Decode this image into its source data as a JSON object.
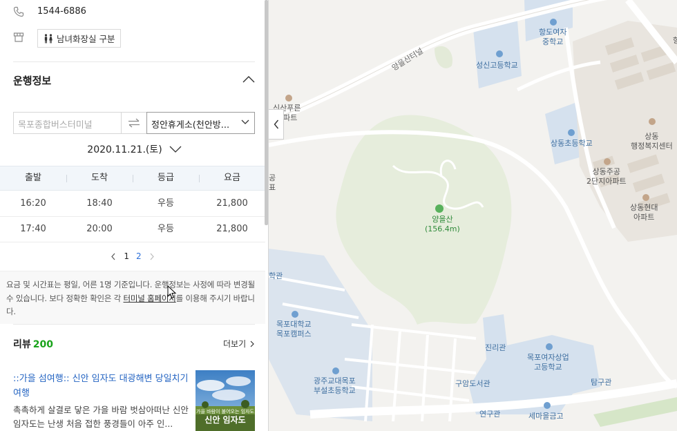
{
  "station": {
    "phone": "1544-6886",
    "toilet_badge": "남녀화장실 구분"
  },
  "schedule": {
    "section_title": "운행정보",
    "from_placeholder": "목포종합버스터미널",
    "to_value": "정안휴게소(천안방...",
    "date": "2020.11.21.(토)",
    "columns": [
      "출발",
      "도착",
      "등급",
      "요금"
    ],
    "rows": [
      {
        "depart": "16:20",
        "arrive": "18:40",
        "grade": "우등",
        "fare": "21,800"
      },
      {
        "depart": "17:40",
        "arrive": "20:00",
        "grade": "우등",
        "fare": "21,800"
      }
    ],
    "pages": [
      "1",
      "2"
    ],
    "current_page": "2",
    "notice_part1": "요금 및 시간표는 평일, 어른 1명 기준입니다. 운행정보는 사정에 따라 변경될 수 있습니다. 보다 정확한 확인은 각 ",
    "notice_link": "터미널 홈페이지",
    "notice_part2": "를 이용해 주시기 바랍니다."
  },
  "reviews": {
    "title": "리뷰",
    "count": "200",
    "more_label": "더보기",
    "item": {
      "title": "::가을 섬여행:: 신안 임자도 대광해변 당일치기 여행",
      "excerpt": "촉촉하게 살결로 닿은 가을 바람 벗삼아떠난 신안 임자도는 난생 처음 접한 풍경들이 아주 인...",
      "thumb_caption": "신안 임자도",
      "thumb_subcaption": "가을 바람이 불어오는 임자도"
    }
  },
  "map": {
    "labels": {
      "road_tunnel": "양을산터널",
      "school_seongsin": "성신고등학교",
      "school_hangdo": "항도여자\n중학교",
      "apt_sinsan": "신산푸른\n아파트",
      "school_sangdong": "상동초등학교",
      "center_sangdong": "상동\n행정복지센터",
      "apt_jugong": "상동주공\n2단지아파트",
      "apt_hyundai": "상동현대\n아파트",
      "mountain": "양을산\n(156.4m)",
      "edge_hak": "학관",
      "univ_mokpo": "목포대학교\n목포캠퍼스",
      "school_gwangju": "광주교대목포\n부설초등학교",
      "hall_jilli": "진리관",
      "school_mokpo_girls": "목포여자상업\n고등학교",
      "hall_guam": "구암도서관",
      "hall_tamgu": "탐구관",
      "hall_yeongu": "연구관",
      "bank_saemaeul": "세마을금고",
      "edge_gong": "공\n표",
      "edge_hang": "항"
    }
  },
  "colors": {
    "accent_green": "#19a31a",
    "link_blue": "#2464c2",
    "map_park": "#e6eddc",
    "map_school": "#d5e1ee"
  }
}
